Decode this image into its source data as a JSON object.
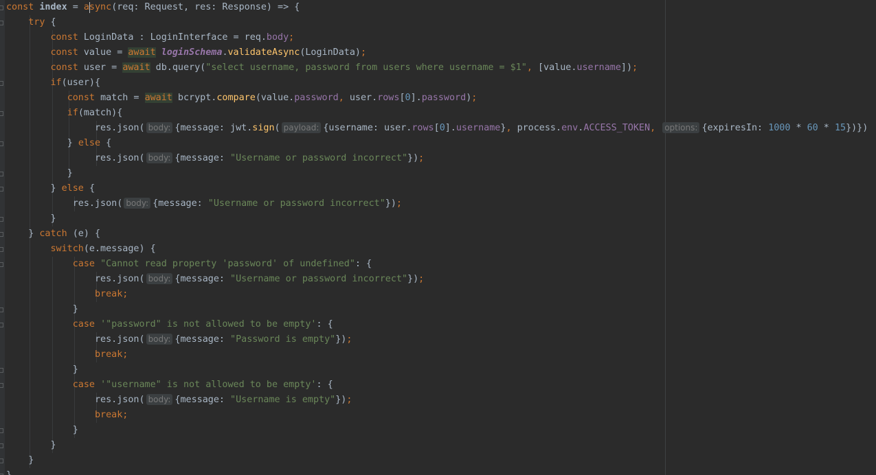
{
  "editor": {
    "language": "TypeScript",
    "colors": {
      "background": "#2b2b2b",
      "keyword": "#cc7832",
      "function": "#ffc66d",
      "property": "#9876aa",
      "string": "#6a8759",
      "number": "#6897bb",
      "default": "#a9b7c6",
      "hint_bg": "#3b3f41"
    },
    "lines": [
      [
        {
          "t": "const ",
          "c": "k"
        },
        {
          "t": "index",
          "c": "bold"
        },
        {
          "t": " = ",
          "c": "d"
        },
        {
          "t": "async",
          "c": "k"
        },
        {
          "t": "(req: Request, res: Response) => {",
          "c": "d"
        }
      ],
      [
        {
          "t": "    "
        },
        {
          "t": "try ",
          "c": "k"
        },
        {
          "t": "{",
          "c": "d"
        }
      ],
      [
        {
          "t": "        "
        },
        {
          "t": "const ",
          "c": "k"
        },
        {
          "t": "LoginData : LoginInterface = req.",
          "c": "d"
        },
        {
          "t": "body",
          "c": "p"
        },
        {
          "t": ";",
          "c": "k"
        }
      ],
      [
        {
          "t": "        "
        },
        {
          "t": "const ",
          "c": "k"
        },
        {
          "t": "value = ",
          "c": "d"
        },
        {
          "t": "await",
          "c": "k aw"
        },
        {
          "t": " ",
          "c": "d"
        },
        {
          "t": "loginSchema",
          "c": "ci"
        },
        {
          "t": ".",
          "c": "d"
        },
        {
          "t": "validateAsync",
          "c": "t"
        },
        {
          "t": "(LoginData)",
          "c": "d"
        },
        {
          "t": ";",
          "c": "k"
        }
      ],
      [
        {
          "t": "        "
        },
        {
          "t": "const ",
          "c": "k"
        },
        {
          "t": "user = ",
          "c": "d"
        },
        {
          "t": "await",
          "c": "k aw"
        },
        {
          "t": " db.query(",
          "c": "d"
        },
        {
          "t": "\"select username, password from users where username = $1\"",
          "c": "s"
        },
        {
          "t": ", ",
          "c": "k"
        },
        {
          "t": "[value.",
          "c": "d"
        },
        {
          "t": "username",
          "c": "p"
        },
        {
          "t": "])",
          "c": "d"
        },
        {
          "t": ";",
          "c": "k"
        }
      ],
      [
        {
          "t": "        "
        },
        {
          "t": "if",
          "c": "k"
        },
        {
          "t": "(user){",
          "c": "d"
        }
      ],
      [
        {
          "t": "           "
        },
        {
          "t": "const ",
          "c": "k"
        },
        {
          "t": "match = ",
          "c": "d"
        },
        {
          "t": "await",
          "c": "k aw"
        },
        {
          "t": " bcrypt.",
          "c": "d"
        },
        {
          "t": "compare",
          "c": "t"
        },
        {
          "t": "(value.",
          "c": "d"
        },
        {
          "t": "password",
          "c": "p"
        },
        {
          "t": ", ",
          "c": "k"
        },
        {
          "t": "user.",
          "c": "d"
        },
        {
          "t": "rows",
          "c": "p"
        },
        {
          "t": "[",
          "c": "d"
        },
        {
          "t": "0",
          "c": "n"
        },
        {
          "t": "].",
          "c": "d"
        },
        {
          "t": "password",
          "c": "p"
        },
        {
          "t": ")",
          "c": "d"
        },
        {
          "t": ";",
          "c": "k"
        }
      ],
      [
        {
          "t": "           "
        },
        {
          "t": "if",
          "c": "k"
        },
        {
          "t": "(match){",
          "c": "d"
        }
      ],
      [
        {
          "t": "                "
        },
        {
          "t": "res.json(",
          "c": "d"
        },
        {
          "hint": "body:"
        },
        {
          "t": "{message: jwt.",
          "c": "d"
        },
        {
          "t": "sign",
          "c": "t"
        },
        {
          "t": "(",
          "c": "d"
        },
        {
          "hint": "payload:"
        },
        {
          "t": "{username: user.",
          "c": "d"
        },
        {
          "t": "rows",
          "c": "p"
        },
        {
          "t": "[",
          "c": "d"
        },
        {
          "t": "0",
          "c": "n"
        },
        {
          "t": "].",
          "c": "d"
        },
        {
          "t": "username",
          "c": "p"
        },
        {
          "t": "}",
          "c": "d"
        },
        {
          "t": ", ",
          "c": "k"
        },
        {
          "t": "process.",
          "c": "d"
        },
        {
          "t": "env",
          "c": "p"
        },
        {
          "t": ".",
          "c": "d"
        },
        {
          "t": "ACCESS_TOKEN",
          "c": "p"
        },
        {
          "t": ", ",
          "c": "k"
        },
        {
          "hint": "options:"
        },
        {
          "t": "{expiresIn: ",
          "c": "d"
        },
        {
          "t": "1000",
          "c": "n"
        },
        {
          "t": " * ",
          "c": "d"
        },
        {
          "t": "60",
          "c": "n"
        },
        {
          "t": " * ",
          "c": "d"
        },
        {
          "t": "15",
          "c": "n"
        },
        {
          "t": "})})",
          "c": "d"
        }
      ],
      [
        {
          "t": "           "
        },
        {
          "t": "} ",
          "c": "d"
        },
        {
          "t": "else ",
          "c": "k"
        },
        {
          "t": "{",
          "c": "d"
        }
      ],
      [
        {
          "t": "                "
        },
        {
          "t": "res.json(",
          "c": "d"
        },
        {
          "hint": "body:"
        },
        {
          "t": "{message: ",
          "c": "d"
        },
        {
          "t": "\"Username or password incorrect\"",
          "c": "s"
        },
        {
          "t": "})",
          "c": "d"
        },
        {
          "t": ";",
          "c": "k"
        }
      ],
      [
        {
          "t": "           "
        },
        {
          "t": "}",
          "c": "d"
        }
      ],
      [
        {
          "t": "        "
        },
        {
          "t": "} ",
          "c": "d"
        },
        {
          "t": "else ",
          "c": "k"
        },
        {
          "t": "{",
          "c": "d"
        }
      ],
      [
        {
          "t": "            "
        },
        {
          "t": "res.json(",
          "c": "d"
        },
        {
          "hint": "body:"
        },
        {
          "t": "{message: ",
          "c": "d"
        },
        {
          "t": "\"Username or password incorrect\"",
          "c": "s"
        },
        {
          "t": "})",
          "c": "d"
        },
        {
          "t": ";",
          "c": "k"
        }
      ],
      [
        {
          "t": "        "
        },
        {
          "t": "}",
          "c": "d"
        }
      ],
      [
        {
          "t": "    "
        },
        {
          "t": "} ",
          "c": "d"
        },
        {
          "t": "catch ",
          "c": "k"
        },
        {
          "t": "(e) {",
          "c": "d"
        }
      ],
      [
        {
          "t": "        "
        },
        {
          "t": "switch",
          "c": "k"
        },
        {
          "t": "(e.message) {",
          "c": "d"
        }
      ],
      [
        {
          "t": "            "
        },
        {
          "t": "case ",
          "c": "k"
        },
        {
          "t": "\"Cannot read property 'password' of undefined\"",
          "c": "s"
        },
        {
          "t": ": {",
          "c": "d"
        }
      ],
      [
        {
          "t": "                "
        },
        {
          "t": "res.json(",
          "c": "d"
        },
        {
          "hint": "body:"
        },
        {
          "t": "{message: ",
          "c": "d"
        },
        {
          "t": "\"Username or password incorrect\"",
          "c": "s"
        },
        {
          "t": "})",
          "c": "d"
        },
        {
          "t": ";",
          "c": "k"
        }
      ],
      [
        {
          "t": "                "
        },
        {
          "t": "break;",
          "c": "k"
        }
      ],
      [
        {
          "t": "            "
        },
        {
          "t": "}",
          "c": "d"
        }
      ],
      [
        {
          "t": "            "
        },
        {
          "t": "case ",
          "c": "k"
        },
        {
          "t": "'\"password\" is not allowed to be empty'",
          "c": "s"
        },
        {
          "t": ": {",
          "c": "d"
        }
      ],
      [
        {
          "t": "                "
        },
        {
          "t": "res.json(",
          "c": "d"
        },
        {
          "hint": "body:"
        },
        {
          "t": "{message: ",
          "c": "d"
        },
        {
          "t": "\"Password is empty\"",
          "c": "s"
        },
        {
          "t": "})",
          "c": "d"
        },
        {
          "t": ";",
          "c": "k"
        }
      ],
      [
        {
          "t": "                "
        },
        {
          "t": "break;",
          "c": "k"
        }
      ],
      [
        {
          "t": "            "
        },
        {
          "t": "}",
          "c": "d"
        }
      ],
      [
        {
          "t": "            "
        },
        {
          "t": "case ",
          "c": "k"
        },
        {
          "t": "'\"username\" is not allowed to be empty'",
          "c": "s"
        },
        {
          "t": ": {",
          "c": "d"
        }
      ],
      [
        {
          "t": "                "
        },
        {
          "t": "res.json(",
          "c": "d"
        },
        {
          "hint": "body:"
        },
        {
          "t": "{message: ",
          "c": "d"
        },
        {
          "t": "\"Username is empty\"",
          "c": "s"
        },
        {
          "t": "})",
          "c": "d"
        },
        {
          "t": ";",
          "c": "k"
        }
      ],
      [
        {
          "t": "                "
        },
        {
          "t": "break;",
          "c": "k"
        }
      ],
      [
        {
          "t": "            "
        },
        {
          "t": "}",
          "c": "d"
        }
      ],
      [
        {
          "t": "        "
        },
        {
          "t": "}",
          "c": "d"
        }
      ],
      [
        {
          "t": "    "
        },
        {
          "t": "}",
          "c": "d"
        }
      ],
      [
        {
          "t": "}",
          "c": "d"
        }
      ]
    ]
  }
}
